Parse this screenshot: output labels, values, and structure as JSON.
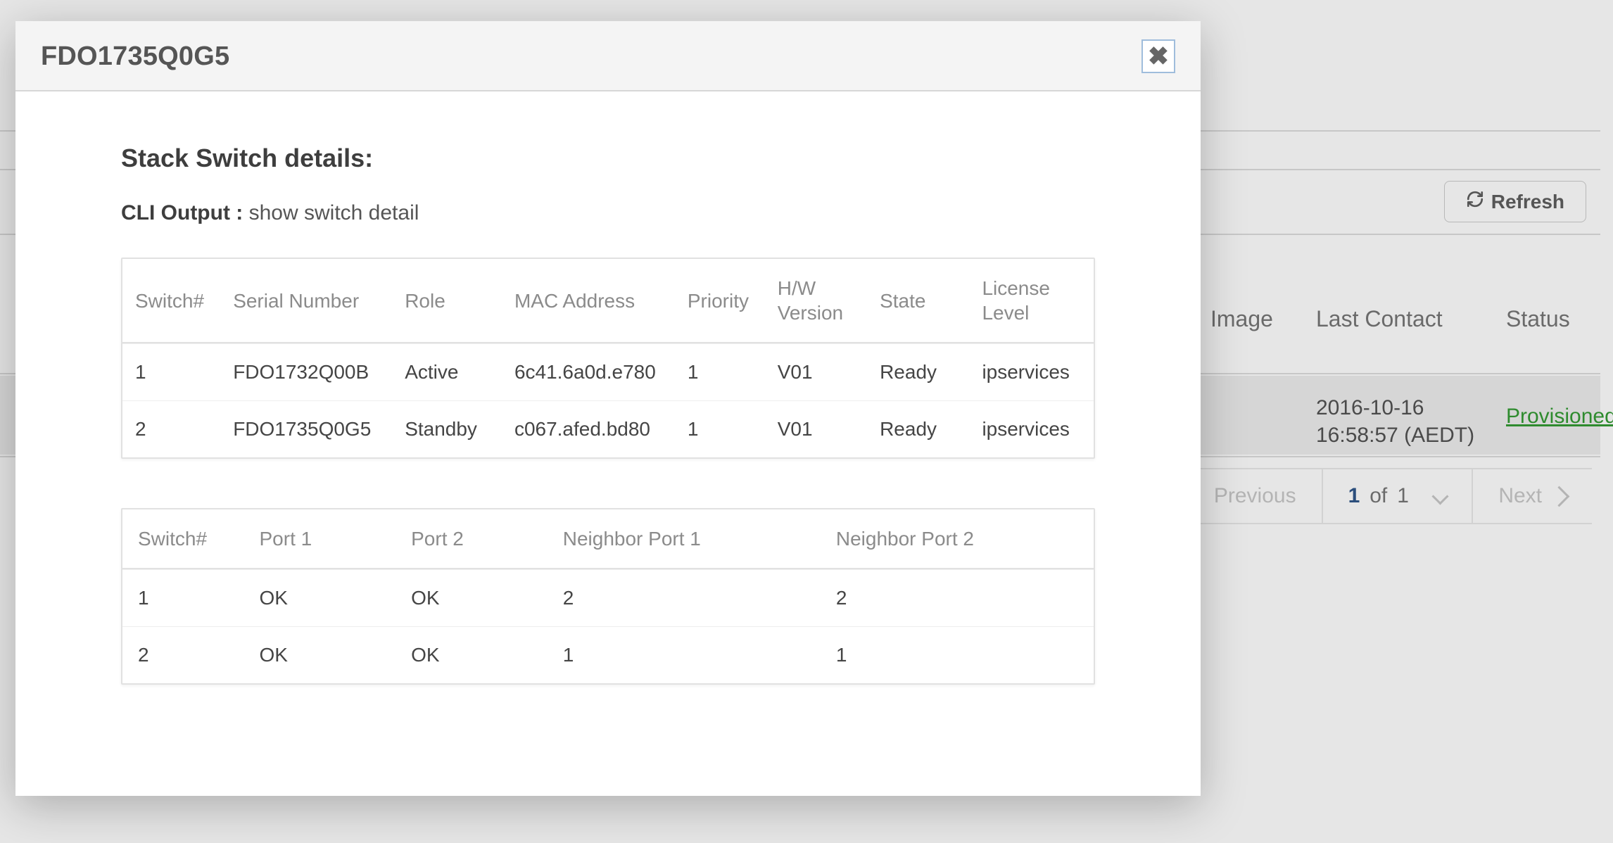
{
  "background": {
    "refresh_label": "Refresh",
    "columns": {
      "image": "Image",
      "last_contact": "Last Contact",
      "status": "Status"
    },
    "row": {
      "last_contact_line1": "2016-10-16",
      "last_contact_line2": "16:58:57 (AEDT)",
      "status": "Provisioned"
    },
    "pager": {
      "previous": "Previous",
      "next": "Next",
      "current_page": "1",
      "of_label": "of",
      "total_pages": "1"
    }
  },
  "modal": {
    "title": "FDO1735Q0G5",
    "section_title": "Stack Switch details:",
    "cli_label": "CLI Output :",
    "cli_command": "show switch detail",
    "switch_table": {
      "headers": {
        "switch": "Switch#",
        "serial": "Serial Number",
        "role": "Role",
        "mac": "MAC Address",
        "priority": "Priority",
        "hw": "H/W Version",
        "state": "State",
        "license": "License Level"
      },
      "rows": [
        {
          "switch": "1",
          "serial": "FDO1732Q00B",
          "role": "Active",
          "role_active": true,
          "mac": "6c41.6a0d.e780",
          "priority": "1",
          "hw": "V01",
          "state": "Ready",
          "license": "ipservices"
        },
        {
          "switch": "2",
          "serial": "FDO1735Q0G5",
          "role": "Standby",
          "role_active": false,
          "mac": "c067.afed.bd80",
          "priority": "1",
          "hw": "V01",
          "state": "Ready",
          "license": "ipservices"
        }
      ]
    },
    "port_table": {
      "headers": {
        "switch": "Switch#",
        "port1": "Port 1",
        "port2": "Port 2",
        "n1": "Neighbor Port 1",
        "n2": "Neighbor Port 2"
      },
      "rows": [
        {
          "switch": "1",
          "port1": "OK",
          "port2": "OK",
          "n1": "2",
          "n2": "2"
        },
        {
          "switch": "2",
          "port1": "OK",
          "port2": "OK",
          "n1": "1",
          "n2": "1"
        }
      ]
    }
  }
}
